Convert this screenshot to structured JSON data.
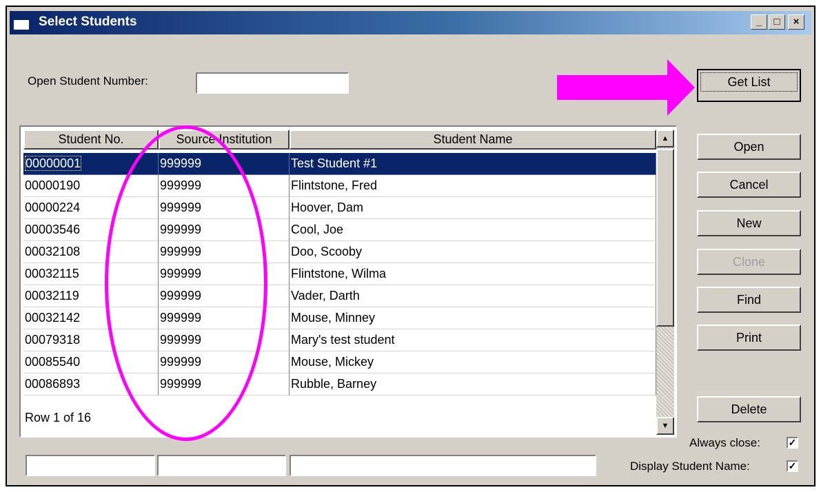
{
  "window": {
    "title": "Select Students"
  },
  "titlebar_buttons": {
    "minimize": "_",
    "maximize": "□",
    "close": "×"
  },
  "form": {
    "open_student_number_label": "Open Student Number:",
    "open_student_number_value": ""
  },
  "buttons": {
    "get_list": "Get List",
    "open": "Open",
    "cancel": "Cancel",
    "new": "New",
    "clone": "Clone",
    "find": "Find",
    "print": "Print",
    "delete": "Delete"
  },
  "table": {
    "columns": [
      "Student No.",
      "Source Institution",
      "Student Name"
    ],
    "rows": [
      {
        "student_no": "00000001",
        "source_institution": "999999",
        "student_name": "Test Student #1"
      },
      {
        "student_no": "00000190",
        "source_institution": "999999",
        "student_name": "Flintstone, Fred"
      },
      {
        "student_no": "00000224",
        "source_institution": "999999",
        "student_name": "Hoover, Dam"
      },
      {
        "student_no": "00003546",
        "source_institution": "999999",
        "student_name": "Cool, Joe"
      },
      {
        "student_no": "00032108",
        "source_institution": "999999",
        "student_name": "Doo, Scooby"
      },
      {
        "student_no": "00032115",
        "source_institution": "999999",
        "student_name": "Flintstone, Wilma"
      },
      {
        "student_no": "00032119",
        "source_institution": "999999",
        "student_name": "Vader, Darth"
      },
      {
        "student_no": "00032142",
        "source_institution": "999999",
        "student_name": "Mouse, Minney"
      },
      {
        "student_no": "00079318",
        "source_institution": "999999",
        "student_name": "Mary's test student"
      },
      {
        "student_no": "00085540",
        "source_institution": "999999",
        "student_name": "Mouse, Mickey"
      },
      {
        "student_no": "00086893",
        "source_institution": "999999",
        "student_name": "Rubble, Barney"
      }
    ],
    "selected_row": 0,
    "status": "Row 1 of 16"
  },
  "filters": {
    "student_no": "",
    "source_institution": "",
    "student_name": ""
  },
  "options": {
    "always_close_label": "Always close:",
    "always_close_checked": true,
    "display_student_name_label": "Display Student Name:",
    "display_student_name_checked": true
  },
  "icons": {
    "window_icon": "window-icon",
    "scroll_up": "up-arrow-icon",
    "scroll_down": "down-arrow-icon",
    "checkmark": "checkmark-icon"
  },
  "colors": {
    "highlight": "#ff00ff",
    "selection": "#0a246a",
    "window_bg": "#d4d0c8"
  }
}
